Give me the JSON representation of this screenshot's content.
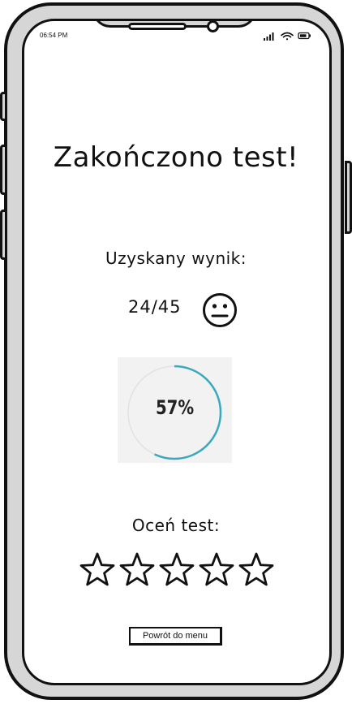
{
  "status_bar": {
    "time": "06:54 PM",
    "icons": [
      "signal-icon",
      "wifi-icon",
      "battery-icon"
    ]
  },
  "content": {
    "title": "Zakończono test!",
    "score_label": "Uzyskany wynik:",
    "score_value": "24/45",
    "score_icon": "neutral-face-icon",
    "progress": {
      "percent_text": "57%",
      "fraction": 0.57,
      "color": "#3aa9be"
    },
    "rate_label": "Oceń test:",
    "stars": {
      "count": 5,
      "selected": 0,
      "icon": "star-outline-icon"
    },
    "menu_button": "Powrót do menu"
  },
  "colors": {
    "frame": "#d6d6d6",
    "outline": "#111111",
    "progress_track": "#e2e2e2",
    "progress_arc": "#3aa9be"
  }
}
